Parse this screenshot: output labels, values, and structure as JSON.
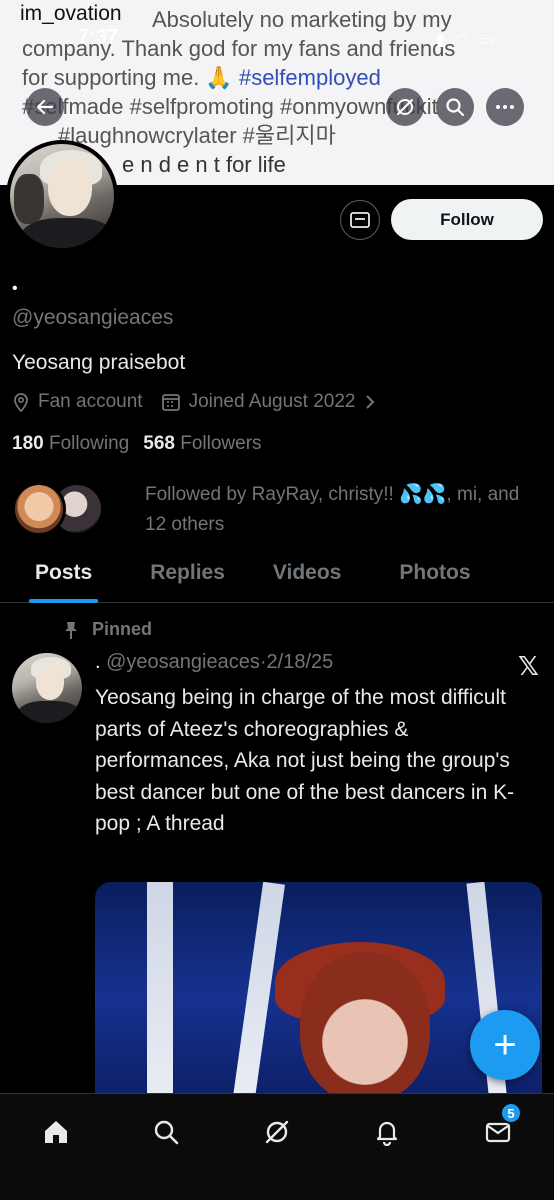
{
  "status_bar": {
    "time": "7:37"
  },
  "banner": {
    "username": "im_ovation",
    "line1": "Absolutely no marketing by my",
    "line2": "company. Thank god for my fans and friends",
    "line3_text": "for supporting me. 🙏",
    "line3_tag": "#selfemployed",
    "line4_tag": "#selfmade #selfpromoting #onmyownfuckit",
    "line5_tag": "#laughnowcrylater #울리지마",
    "line6": "e n d e n t for life"
  },
  "profile": {
    "follow_label": "Follow",
    "display_name": "•",
    "handle": "@yeosangieaces",
    "bio": "Yeosang praisebot",
    "category": "Fan account",
    "joined": "Joined August 2022",
    "following_count": "180",
    "following_label": "Following",
    "followers_count": "568",
    "followers_label": "Followers",
    "followed_by": "Followed by RayRay, christy!! 💦💦, mi, and 12 others"
  },
  "tabs": [
    {
      "label": "Posts",
      "active": true
    },
    {
      "label": "Replies",
      "active": false
    },
    {
      "label": "Videos",
      "active": false
    },
    {
      "label": "Photos",
      "active": false
    }
  ],
  "post": {
    "pinned_label": "Pinned",
    "author_dot": ".",
    "handle": "@yeosangieaces",
    "separator": "·",
    "date": "2/18/25",
    "text": "Yeosang being in charge of the most difficult parts of Ateez's choreographies & performances, Aka not just being the group's best dancer but one of the best dancers in K-pop ; A thread"
  },
  "fab": {
    "label": "+"
  },
  "bottom_nav": {
    "items": [
      "home-icon",
      "search-icon",
      "grok-icon",
      "notifications-icon",
      "messages-icon"
    ],
    "messages_badge": "5"
  },
  "colors": {
    "accent": "#1d9bf0",
    "background": "#000000",
    "muted": "#71767b"
  }
}
